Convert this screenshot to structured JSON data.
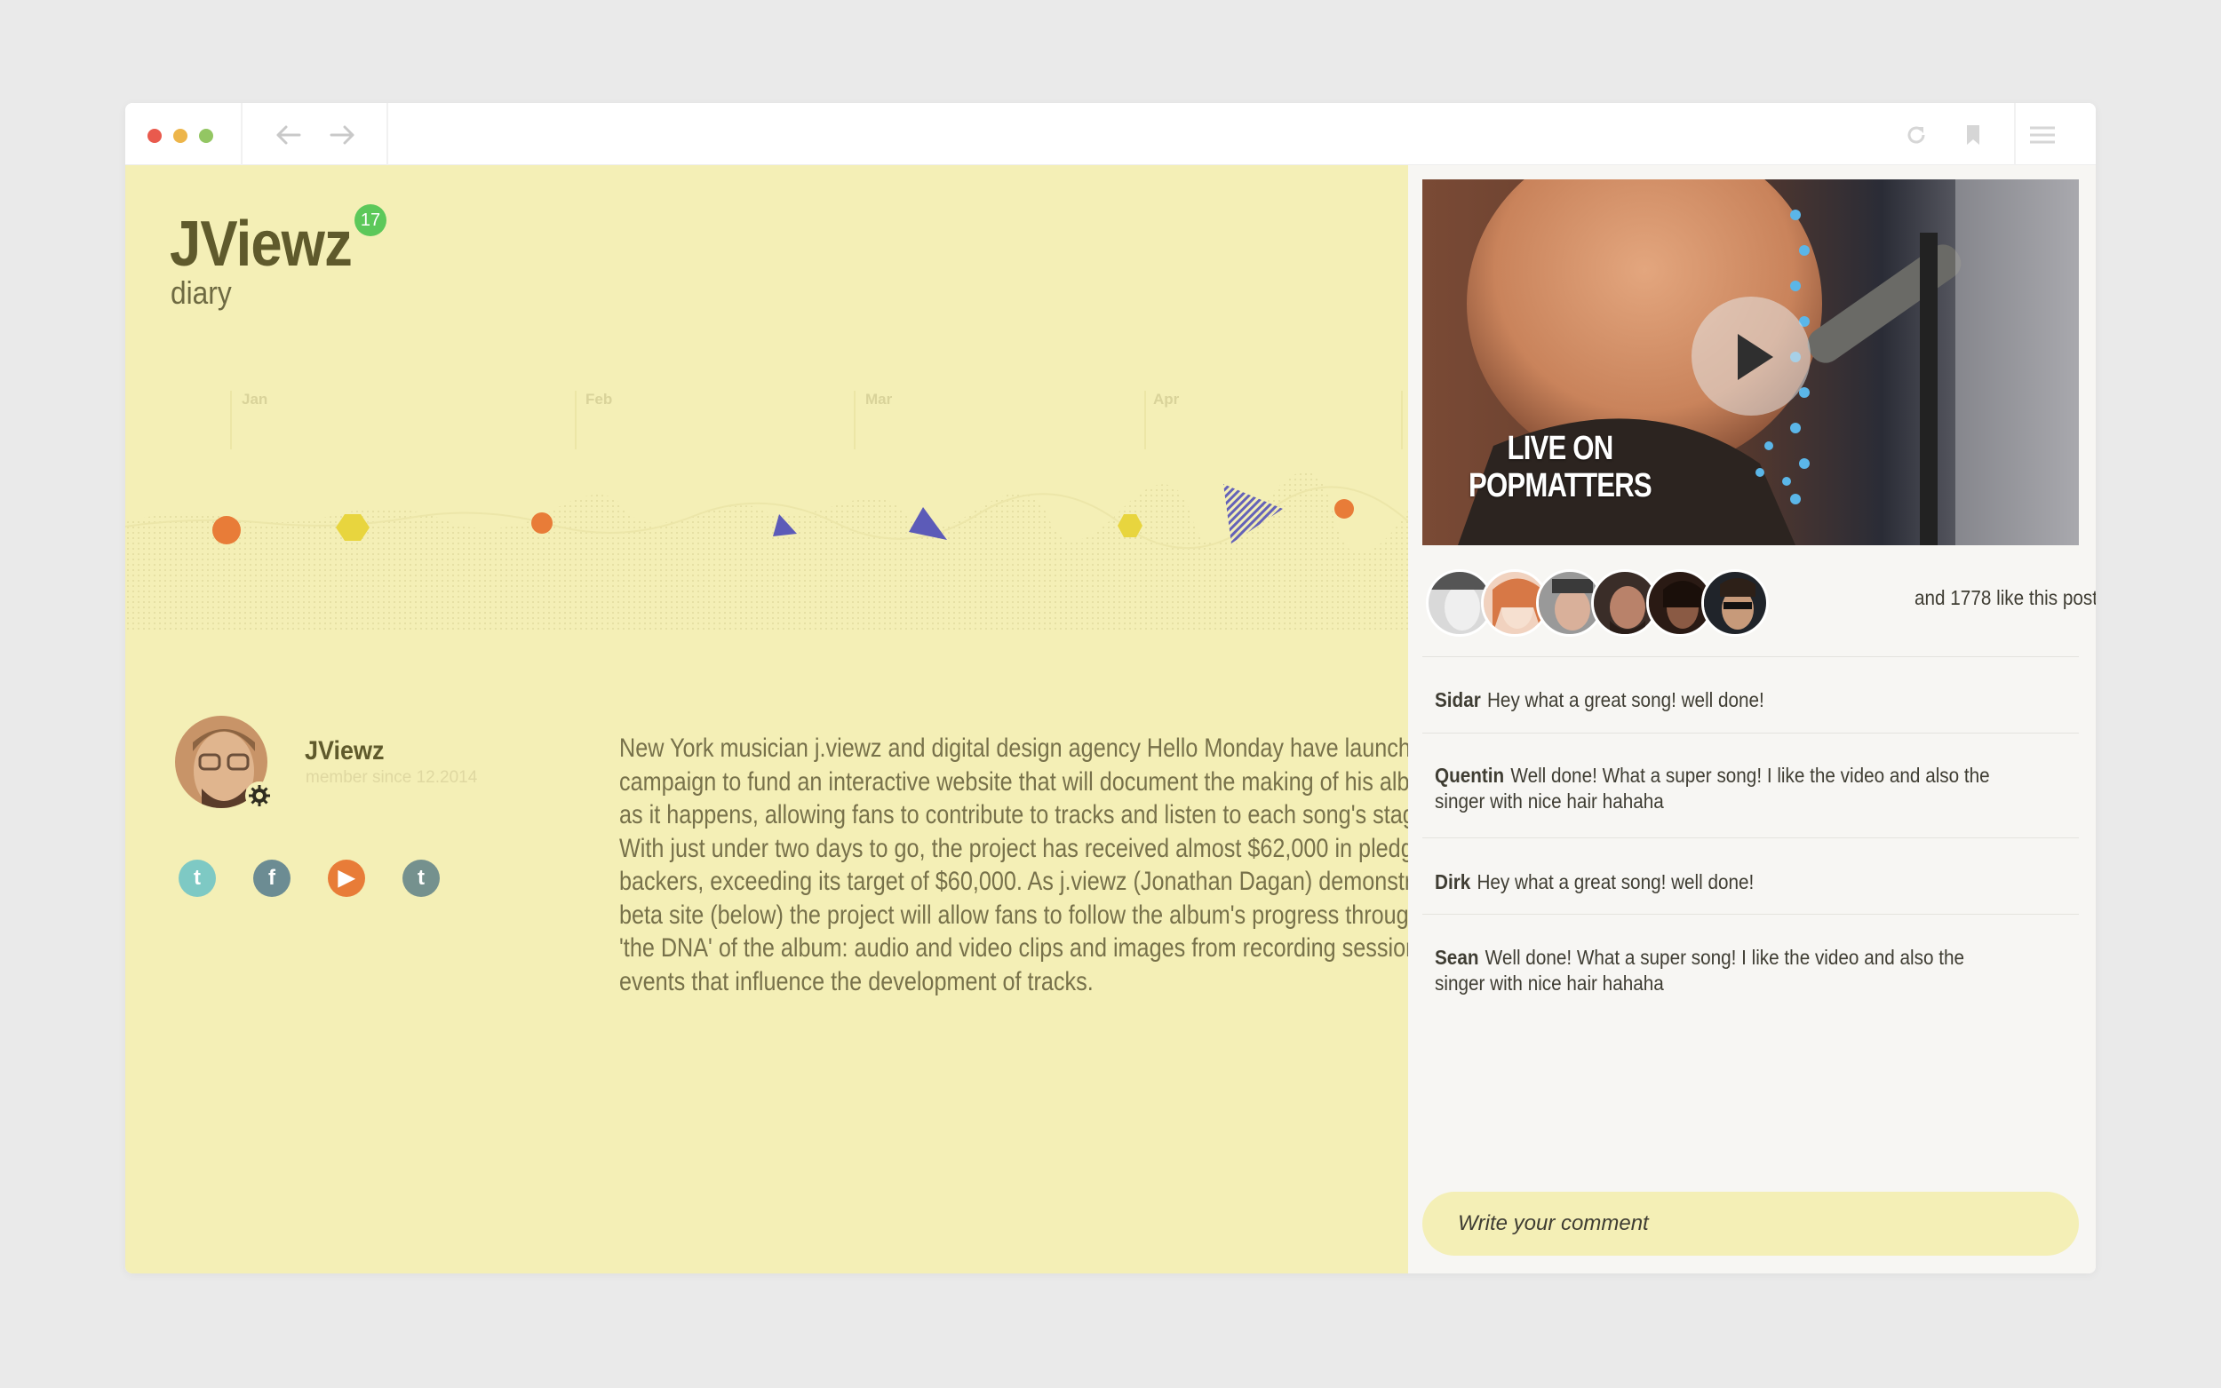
{
  "browser": {
    "icons": [
      "arrow-left",
      "arrow-right",
      "reload",
      "bookmark",
      "menu"
    ]
  },
  "profile_header": {
    "title": "JViewz",
    "badge_count": "17",
    "subtitle": "diary"
  },
  "timeline": {
    "months": [
      "Jan",
      "Feb",
      "Mar",
      "Apr"
    ]
  },
  "user": {
    "name": "JViewz",
    "member_since": "member since 12.2014"
  },
  "social": [
    "t",
    "f",
    "▶",
    "t"
  ],
  "post": {
    "lines": [
      "New York musician j.viewz and digital design agency Hello Monday have launched a",
      "campaign to fund an interactive website that will document the making of his album",
      "as it happens, allowing fans to contribute to tracks and listen to each song's stages.",
      "With just under two days to go, the project has received almost $62,000 in pledges from",
      "backers, exceeding its target of $60,000. As j.viewz (Jonathan Dagan) demonstrates in a",
      "beta site (below) the project will allow fans to follow the album's progress through",
      "'the DNA' of the album: audio and video clips and images from recording sessions and",
      "events that influence the development of tracks."
    ]
  },
  "video": {
    "caption_line1": "LIVE ON",
    "caption_line2": "POPMATTERS"
  },
  "likes": {
    "text": "and 1778 like this post"
  },
  "comments": [
    {
      "author": "Sidar",
      "text": "Hey what a great song! well done!"
    },
    {
      "author": "Quentin",
      "text": "Well done! What a super song! I like the video and also the singer with nice hair hahaha"
    },
    {
      "author": "Dirk",
      "text": "Hey what a great song! well done!"
    },
    {
      "author": "Sean",
      "text": "Well done! What a super song! I like the video and also the singer with nice hair hahaha"
    }
  ],
  "comment_input": {
    "placeholder": "Write your comment"
  },
  "colors": {
    "left_background": "#f4efb6",
    "accent_orange": "#e87c38",
    "accent_yellow": "#e8d53e",
    "accent_purple": "#5c5bb8",
    "badge_green": "#5cc85a"
  }
}
